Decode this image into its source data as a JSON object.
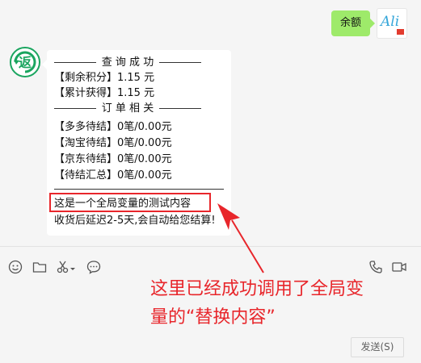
{
  "outgoing": {
    "text": "余额"
  },
  "self_avatar": {
    "text": "Ali"
  },
  "reply": {
    "query_header": "查 询 成 功",
    "remaining_points": "【剩余积分】1.15 元",
    "total_earned": "【累计获得】1.15 元",
    "order_header": "订 单 相 关",
    "duoduo_pending": "【多多待结】0笔/0.00元",
    "taobao_pending": "【淘宝待结】0笔/0.00元",
    "jd_pending": "【京东待结】0笔/0.00元",
    "pending_total": "【待结汇总】0笔/0.00元",
    "global_var_text": "这是一个全局变量的测试内容",
    "settlement_note": "收货后延迟2-5天,会自动给您结算!"
  },
  "annotation": {
    "line1": "这里已经成功调用了全局变",
    "line2": "量的“替换内容”"
  },
  "send_button": {
    "label": "发送(S)"
  },
  "colors": {
    "bubble_green": "#9eea6a",
    "annotation_red": "#e8262b",
    "bot_green": "#1aa55f"
  },
  "icons": [
    "emoji-icon",
    "folder-icon",
    "scissors-icon",
    "chat-bubble-icon",
    "phone-icon",
    "video-call-icon"
  ]
}
